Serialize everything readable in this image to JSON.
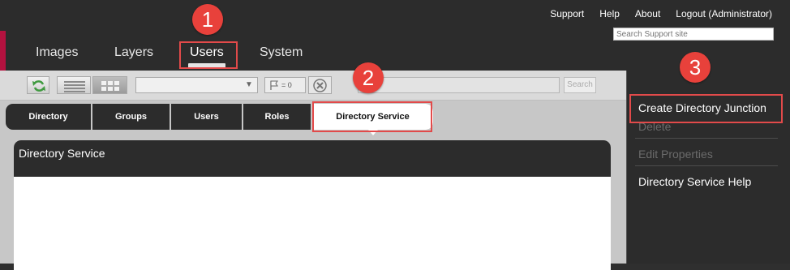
{
  "header": {
    "links": [
      "Support",
      "Help",
      "About",
      "Logout (Administrator)"
    ],
    "search_placeholder": "Search Support site",
    "nav": [
      "Images",
      "Layers",
      "Users",
      "System"
    ],
    "active_nav": "Users",
    "accent_color": "#b3123f"
  },
  "toolbar": {
    "flag_count": "= 0",
    "search_button": "Search",
    "icons": [
      "refresh-icon",
      "list-view-icon",
      "grid-view-icon",
      "flag-icon",
      "clear-icon"
    ]
  },
  "subtabs": [
    "Directory",
    "Groups",
    "Users",
    "Roles",
    "Directory Service"
  ],
  "active_subtab": "Directory Service",
  "panel": {
    "title": "Directory Service"
  },
  "sidebar": {
    "actions": [
      {
        "label": "Create Directory Junction",
        "enabled": true
      },
      {
        "label": "Delete",
        "enabled": false
      },
      {
        "label": "Edit Properties",
        "enabled": false
      },
      {
        "label": "Directory Service Help",
        "enabled": true
      }
    ]
  },
  "callouts": [
    "1",
    "2",
    "3"
  ],
  "callout_color": "#e8413b"
}
